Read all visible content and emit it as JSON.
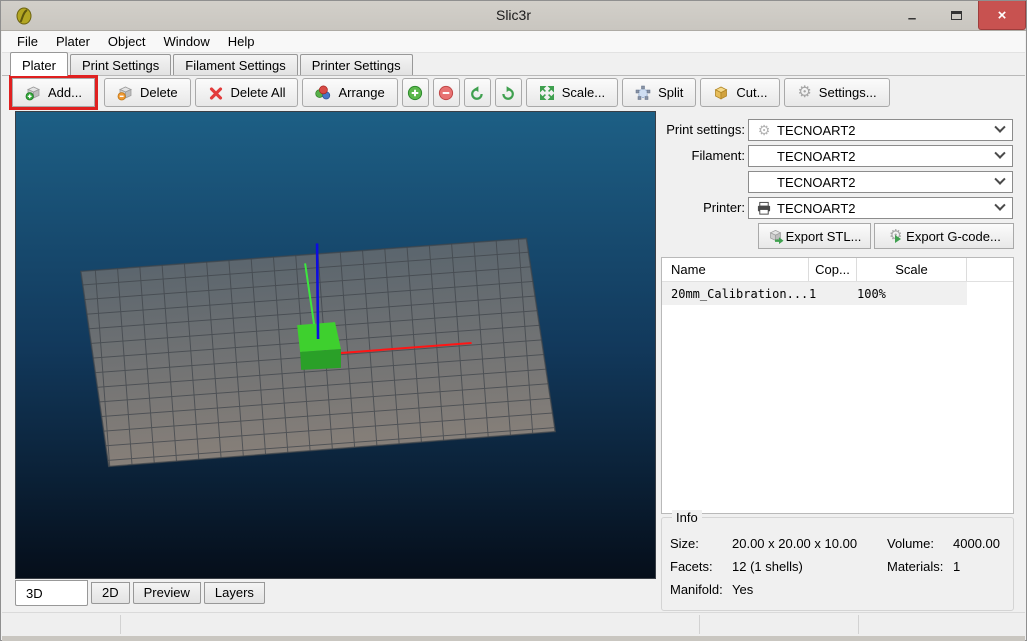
{
  "window": {
    "title": "Slic3r"
  },
  "icons": {
    "close": "×",
    "minimize": "–",
    "gear": "⚙"
  },
  "menu": {
    "items": [
      {
        "label": "File"
      },
      {
        "label": "Plater"
      },
      {
        "label": "Object"
      },
      {
        "label": "Window"
      },
      {
        "label": "Help"
      }
    ]
  },
  "tabs": {
    "items": [
      {
        "label": "Plater",
        "active": true
      },
      {
        "label": "Print Settings"
      },
      {
        "label": "Filament Settings"
      },
      {
        "label": "Printer Settings"
      }
    ]
  },
  "toolbar": {
    "add_label": "Add...",
    "delete_label": "Delete",
    "delete_all_label": "Delete All",
    "arrange_label": "Arrange",
    "scale_label": "Scale...",
    "split_label": "Split",
    "cut_label": "Cut...",
    "settings_label": "Settings...",
    "add_highlight_color": "#e02020"
  },
  "settings_panel": {
    "print_settings_label": "Print settings:",
    "print_settings_value": "TECNOART2",
    "filament_label": "Filament:",
    "filament1_value": "TECNOART2",
    "filament2_value": "TECNOART2",
    "printer_label": "Printer:",
    "printer_value": "TECNOART2",
    "export_stl_label": "Export STL...",
    "export_gcode_label": "Export G-code..."
  },
  "object_table": {
    "headers": [
      "Name",
      "Cop...",
      "Scale"
    ],
    "rows": [
      {
        "name": "20mm_Calibration...",
        "copies": "1",
        "scale": "100%"
      }
    ]
  },
  "info": {
    "legend": "Info",
    "size_label": "Size:",
    "size_value": "20.00 x 20.00 x 10.00",
    "volume_label": "Volume:",
    "volume_value": "4000.00",
    "facets_label": "Facets:",
    "facets_value": "12 (1 shells)",
    "materials_label": "Materials:",
    "materials_value": "1",
    "manifold_label": "Manifold:",
    "manifold_value": "Yes"
  },
  "view_tabs": {
    "items": [
      {
        "label": "3D",
        "active": true
      },
      {
        "label": "2D"
      },
      {
        "label": "Preview"
      },
      {
        "label": "Layers"
      }
    ]
  },
  "viewport": {
    "background_top": "#1d5f85",
    "background_mid": "#12395c",
    "background_bottom": "#050e1a",
    "bed_top": "#59636b",
    "bed_bottom": "#91877e",
    "cube_top": "#3ed02e",
    "cube_front": "#2aa028",
    "axis_x": "#ff1515",
    "axis_y": "#3ce83e",
    "axis_z": "#0d0de0"
  }
}
